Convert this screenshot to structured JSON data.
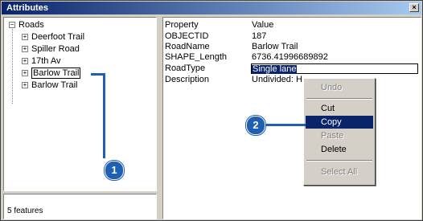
{
  "window": {
    "title": "Attributes",
    "close_label": "×"
  },
  "tree": {
    "root": {
      "label": "Roads",
      "expander": "−"
    },
    "items": [
      {
        "label": "Deerfoot Trail",
        "expander": "+"
      },
      {
        "label": "Spiller Road",
        "expander": "+"
      },
      {
        "label": "17th Av",
        "expander": "+"
      },
      {
        "label": "Barlow Trail",
        "expander": "+"
      },
      {
        "label": "Barlow Trail",
        "expander": "+"
      }
    ]
  },
  "status": {
    "text": "5 features"
  },
  "properties": {
    "header_property": "Property",
    "header_value": "Value",
    "rows": [
      {
        "name": "OBJECTID",
        "value": "187"
      },
      {
        "name": "RoadName",
        "value": "Barlow Trail"
      },
      {
        "name": "SHAPE_Length",
        "value": "6736.41996689892"
      },
      {
        "name": "RoadType",
        "value": "Single lane"
      },
      {
        "name": "Description",
        "value": "Undivided: H"
      }
    ]
  },
  "context_menu": {
    "items": [
      {
        "label": "Undo",
        "enabled": false
      },
      {
        "label": "Cut",
        "enabled": true
      },
      {
        "label": "Copy",
        "enabled": true,
        "highlighted": true
      },
      {
        "label": "Paste",
        "enabled": false
      },
      {
        "label": "Delete",
        "enabled": true
      },
      {
        "label": "Select All",
        "enabled": false
      }
    ]
  },
  "callouts": [
    {
      "number": "1"
    },
    {
      "number": "2"
    }
  ],
  "colors": {
    "callout": "#1f5fb4",
    "selection": "#0a246a",
    "titlebar": "#0a246a"
  }
}
